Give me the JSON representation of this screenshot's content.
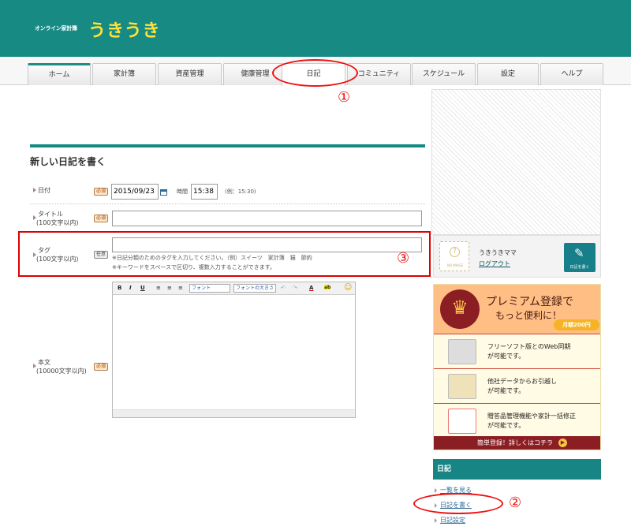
{
  "header": {
    "subtitle": "オンライン家計簿",
    "title": "うきうき"
  },
  "tabs": [
    {
      "label": "ホーム"
    },
    {
      "label": "家計簿"
    },
    {
      "label": "資産管理"
    },
    {
      "label": "健康管理"
    },
    {
      "label": "日記"
    },
    {
      "label": "コミュニティ"
    },
    {
      "label": "スケジュール"
    },
    {
      "label": "設定"
    },
    {
      "label": "ヘルプ"
    }
  ],
  "annotations": {
    "one": "①",
    "two": "②",
    "three": "③"
  },
  "form": {
    "title": "新しい日記を書く",
    "date_label": "日付",
    "required": "必須",
    "optional": "任意",
    "date_value": "2015/09/23",
    "time_label": "時間",
    "time_value": "15:38",
    "time_example": "(例：15:30)",
    "title_label": "タイトル",
    "title_limit": "(100文字以内)",
    "tag_label": "タグ",
    "tag_limit": "(100文字以内)",
    "tag_note1": "※日記分類のためのタグを入力してください。（例）スイーツ　家計簿　猫　節約",
    "tag_note2": "※キーワードをスペースで区切り、複数入力することができます。",
    "body_label": "本文",
    "body_limit": "(10000文字以内)"
  },
  "editor": {
    "bold": "B",
    "italic": "I",
    "underline": "U",
    "font": "フォント",
    "font_size": "フォントの大きさ",
    "undo": "↶",
    "redo": "↷",
    "text_color": "A",
    "highlight": "ab",
    "emoji": "☺"
  },
  "sidebar": {
    "avatar_text": "NO IMAGE",
    "user_name": "うきうきママ",
    "logout": "ログアウト",
    "write_button": "日記を書く",
    "premium": {
      "title1": "プレミアム登録で",
      "title2": "もっと便利に！",
      "price": "月額200円",
      "f1a": "フリーソフト版とのWeb同期",
      "f1b": "が可能です。",
      "f2a": "他社データからお引越し",
      "f2b": "が可能です。",
      "f3a": "贈答品管理機能や家計一括修正",
      "f3b": "が可能です。",
      "cta": "簡単登録！詳しくはコチラ"
    },
    "section_title": "日記",
    "links": [
      "一覧を見る",
      "日記を書く",
      "日記設定"
    ]
  },
  "colors": {
    "teal": "#168a83",
    "title_yellow": "#ffe23a",
    "annotation_red": "#e11111",
    "premium_dark": "#8b1e23"
  }
}
